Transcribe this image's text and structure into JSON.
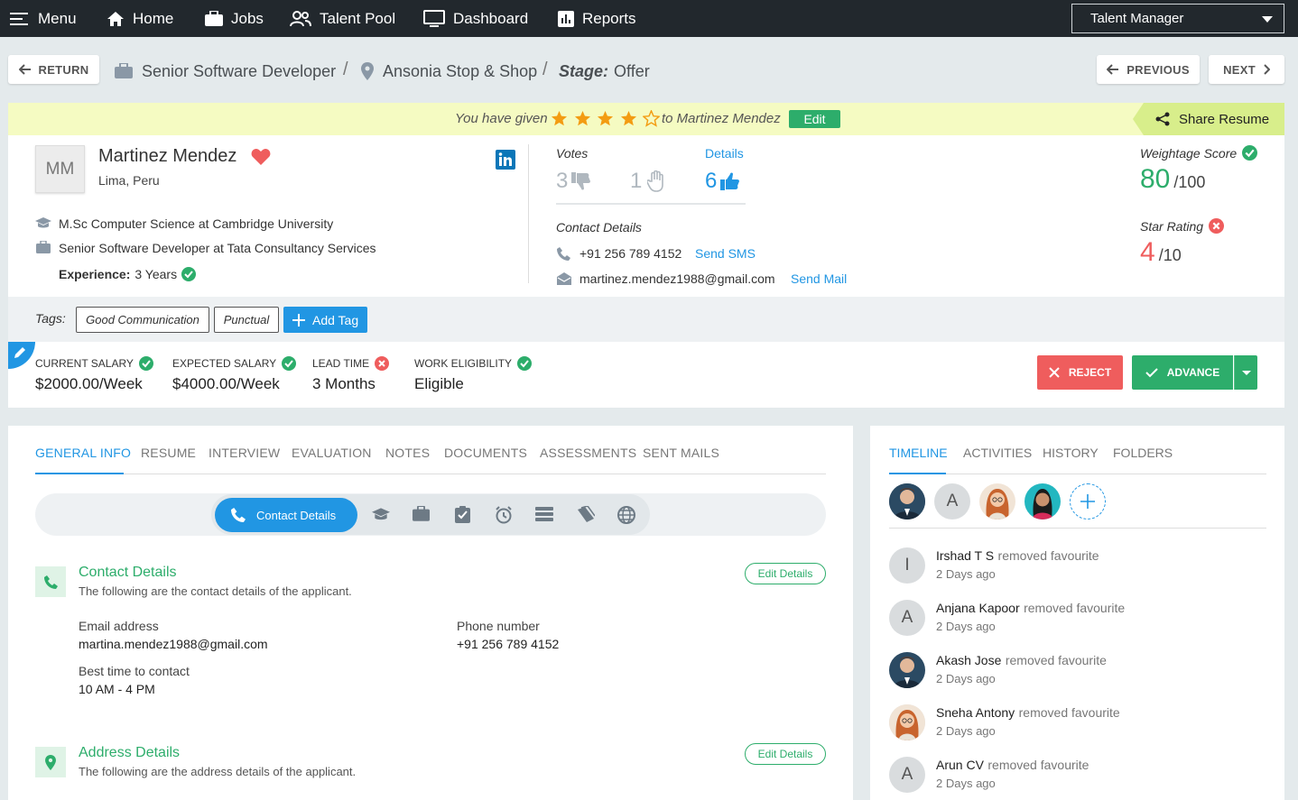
{
  "nav": {
    "menu": "Menu",
    "home": "Home",
    "jobs": "Jobs",
    "talent_pool": "Talent Pool",
    "dashboard": "Dashboard",
    "reports": "Reports",
    "role": "Talent Manager"
  },
  "breadcrumb": {
    "return": "RETURN",
    "job": "Senior Software Developer",
    "location": "Ansonia Stop & Shop",
    "stage_label": "Stage:",
    "stage_value": "Offer",
    "previous": "PREVIOUS",
    "next": "NEXT"
  },
  "rating_bar": {
    "prefix": "You have given",
    "stars_given": 4,
    "stars_total": 5,
    "suffix": "to Martinez Mendez",
    "edit": "Edit",
    "share": "Share Resume"
  },
  "candidate": {
    "initials": "MM",
    "name": "Martinez Mendez",
    "location": "Lima, Peru",
    "education": "M.Sc Computer Science at Cambridge University",
    "job": "Senior Software Developer at Tata Consultancy Services",
    "experience_label": "Experience:",
    "experience_value": "3 Years"
  },
  "votes": {
    "label": "Votes",
    "details": "Details",
    "down": "3",
    "neutral": "1",
    "up": "6"
  },
  "contact": {
    "label": "Contact Details",
    "phone": "+91 256 789 4152",
    "send_sms": "Send SMS",
    "email": "martinez.mendez1988@gmail.com",
    "send_mail": "Send Mail"
  },
  "scores": {
    "weightage_label": "Weightage Score",
    "weightage_value": "80",
    "weightage_total": "/100",
    "star_label": "Star Rating",
    "star_value": "4",
    "star_total": "/10"
  },
  "tags": {
    "label": "Tags:",
    "items": [
      "Good Communication",
      "Punctual"
    ],
    "add": "Add Tag"
  },
  "salary": {
    "current_label": "CURRENT SALARY",
    "current_value": "$2000.00/Week",
    "expected_label": "EXPECTED SALARY",
    "expected_value": "$4000.00/Week",
    "lead_label": "LEAD TIME",
    "lead_value": "3 Months",
    "work_label": "WORK ELIGIBILITY",
    "work_value": "Eligible"
  },
  "actions": {
    "reject": "REJECT",
    "advance": "ADVANCE"
  },
  "tabs": [
    "GENERAL INFO",
    "RESUME",
    "INTERVIEW",
    "EVALUATION",
    "NOTES",
    "DOCUMENTS",
    "ASSESSMENTS",
    "SENT MAILS"
  ],
  "pill": {
    "active": "Contact Details"
  },
  "contact_section": {
    "title": "Contact Details",
    "subtitle": "The following are the contact details of the applicant.",
    "edit": "Edit Details",
    "email_label": "Email address",
    "email_value": "martina.mendez1988@gmail.com",
    "phone_label": "Phone number",
    "phone_value": "+91 256 789 4152",
    "best_time_label": "Best time to contact",
    "best_time_value": "10 AM - 4 PM"
  },
  "address_section": {
    "title": "Address Details",
    "subtitle": "The following are the address details of the applicant.",
    "edit": "Edit Details"
  },
  "right_tabs": [
    "TIMELINE",
    "ACTIVITIES",
    "HISTORY",
    "FOLDERS"
  ],
  "watchers": {
    "letter": "A"
  },
  "timeline": [
    {
      "initial": "I",
      "name": "Irshad T S",
      "action": "removed favourite",
      "time": "2 Days ago"
    },
    {
      "initial": "A",
      "name": "Anjana Kapoor",
      "action": "removed favourite",
      "time": "2 Days ago"
    },
    {
      "initial": "",
      "name": "Akash Jose",
      "action": "removed favourite",
      "time": "2 Days ago"
    },
    {
      "initial": "",
      "name": "Sneha Antony",
      "action": "removed favourite",
      "time": "2 Days ago"
    },
    {
      "initial": "A",
      "name": "Arun CV",
      "action": "removed favourite",
      "time": "2 Days ago"
    }
  ]
}
